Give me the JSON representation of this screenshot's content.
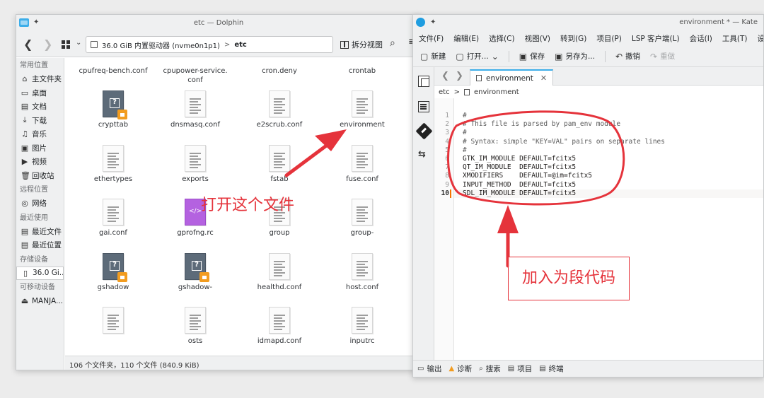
{
  "colors": {
    "accent": "#3daee9",
    "annotation_red": "#e5333b",
    "modified_marker": "#f67400"
  },
  "dolphin": {
    "title": "etc — Dolphin",
    "location": {
      "drive": "36.0 GiB 内置驱动器 (nvme0n1p1)",
      "separator": ">",
      "current": "etc"
    },
    "split_label": "拆分视图",
    "sidebar": {
      "sections": [
        {
          "heading": "常用位置",
          "items": [
            {
              "icon": "home-icon",
              "glyph": "⌂",
              "label": "主文件夹"
            },
            {
              "icon": "desktop-icon",
              "glyph": "▭",
              "label": "桌面"
            },
            {
              "icon": "documents-icon",
              "glyph": "▤",
              "label": "文档"
            },
            {
              "icon": "download-icon",
              "glyph": "⤓",
              "label": "下载"
            },
            {
              "icon": "music-icon",
              "glyph": "♫",
              "label": "音乐"
            },
            {
              "icon": "pictures-icon",
              "glyph": "▣",
              "label": "图片"
            },
            {
              "icon": "videos-icon",
              "glyph": "▶",
              "label": "视频"
            },
            {
              "icon": "trash-icon",
              "glyph": "🗑",
              "label": "回收站"
            }
          ]
        },
        {
          "heading": "远程位置",
          "items": [
            {
              "icon": "network-icon",
              "glyph": "◎",
              "label": "网络"
            }
          ]
        },
        {
          "heading": "最近使用",
          "items": [
            {
              "icon": "recent-files-icon",
              "glyph": "▤",
              "label": "最近文件"
            },
            {
              "icon": "recent-locations-icon",
              "glyph": "▤",
              "label": "最近位置"
            }
          ]
        },
        {
          "heading": "存储设备",
          "items": [
            {
              "icon": "drive-icon",
              "glyph": "▯",
              "label": "36.0 Gi...",
              "selected": true
            }
          ]
        },
        {
          "heading": "可移动设备",
          "items": [
            {
              "icon": "removable-drive-icon",
              "glyph": "⏏",
              "label": "MANJA..."
            }
          ]
        }
      ]
    },
    "files": [
      {
        "name": "cpufreq-bench.conf",
        "type": "partial"
      },
      {
        "name": "cpupower-service.\nconf",
        "type": "partial"
      },
      {
        "name": "cron.deny",
        "type": "partial"
      },
      {
        "name": "crontab",
        "type": "partial"
      },
      {
        "name": "crypttab",
        "type": "locked"
      },
      {
        "name": "dnsmasq.conf",
        "type": "text"
      },
      {
        "name": "e2scrub.conf",
        "type": "text"
      },
      {
        "name": "environment",
        "type": "text"
      },
      {
        "name": "ethertypes",
        "type": "text"
      },
      {
        "name": "exports",
        "type": "text"
      },
      {
        "name": "fstab",
        "type": "text"
      },
      {
        "name": "fuse.conf",
        "type": "text"
      },
      {
        "name": "gai.conf",
        "type": "text"
      },
      {
        "name": "gprofng.rc",
        "type": "code"
      },
      {
        "name": "group",
        "type": "text"
      },
      {
        "name": "group-",
        "type": "text"
      },
      {
        "name": "gshadow",
        "type": "locked"
      },
      {
        "name": "gshadow-",
        "type": "locked"
      },
      {
        "name": "healthd.conf",
        "type": "text"
      },
      {
        "name": "host.conf",
        "type": "text"
      },
      {
        "name": "",
        "type": "text"
      },
      {
        "name": "osts",
        "type": "text"
      },
      {
        "name": "idmapd.conf",
        "type": "text"
      },
      {
        "name": "inputrc",
        "type": "text"
      }
    ],
    "status": "106 个文件夹，110 个文件 (840.9 KiB)"
  },
  "kate": {
    "title": "environment * — Kate",
    "menu": [
      "文件(F)",
      "编辑(E)",
      "选择(C)",
      "视图(V)",
      "转到(G)",
      "项目(P)",
      "LSP 客户端(L)",
      "会话(I)",
      "工具(T)",
      "设置(S)"
    ],
    "toolbar": {
      "new": "新建",
      "open": "打开...",
      "save": "保存",
      "save_as": "另存为...",
      "undo": "撤销",
      "redo": "重做"
    },
    "tab": {
      "label": "environment",
      "close": "✕"
    },
    "breadcrumb": {
      "folder": "etc",
      "separator": ">",
      "file": "environment"
    },
    "line_numbers": [
      "1",
      "2",
      "3",
      "4",
      "5",
      "6",
      "7",
      "8",
      "9",
      "10"
    ],
    "lines": [
      "#",
      "# This file is parsed by pam_env module",
      "#",
      "# Syntax: simple \"KEY=VAL\" pairs on separate lines",
      "#",
      "GTK_IM_MODULE DEFAULT=fcitx5",
      "QT_IM_MODULE  DEFAULT=fcitx5",
      "XMODIFIERS    DEFAULT=@im=fcitx5",
      "INPUT_METHOD  DEFAULT=fcitx5",
      "SDL_IM_MODULE DEFAULT=fcitx5"
    ],
    "current_line": 10,
    "bottom": {
      "output": "输出",
      "diagnostics": "诊断",
      "search": "搜索",
      "project": "项目",
      "terminal": "终端"
    }
  },
  "annotations": {
    "open_file": "打开这个文件",
    "add_code": "加入为段代码"
  }
}
